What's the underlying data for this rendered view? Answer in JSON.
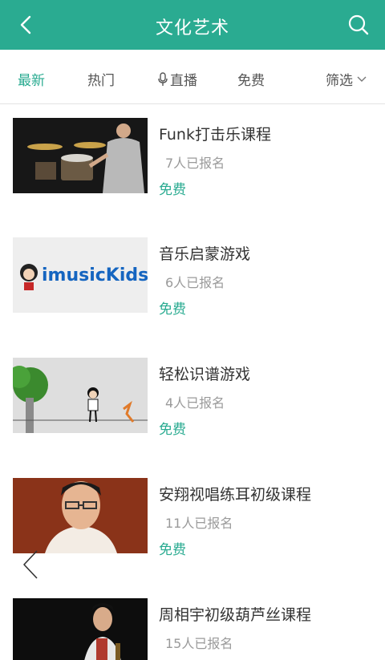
{
  "header": {
    "title": "文化艺术",
    "back_icon": "chevron-left-icon",
    "search_icon": "search-icon",
    "bg_color": "#2aab91"
  },
  "tabs": [
    {
      "label": "最新",
      "active": true
    },
    {
      "label": "热门",
      "active": false
    },
    {
      "label": "直播",
      "icon": "microphone-icon",
      "active": false
    },
    {
      "label": "免费",
      "active": false
    },
    {
      "label": "筛选",
      "icon": "chevron-down-icon",
      "active": false
    }
  ],
  "courses": [
    {
      "title": "Funk打击乐课程",
      "enrolled": "7人已报名",
      "price": "免费",
      "thumb_label": ""
    },
    {
      "title": "音乐启蒙游戏",
      "enrolled": "6人已报名",
      "price": "免费",
      "thumb_label": "imusicKids"
    },
    {
      "title": "轻松识谱游戏",
      "enrolled": "4人已报名",
      "price": "免费",
      "thumb_label": ""
    },
    {
      "title": "安翔视唱练耳初级课程",
      "enrolled": "11人已报名",
      "price": "免费",
      "thumb_label": ""
    },
    {
      "title": "周相宇初级葫芦丝课程",
      "enrolled": "15人已报名",
      "price": "免费",
      "thumb_label": ""
    }
  ],
  "overlay": {
    "icon": "chevron-left-icon"
  },
  "accent_color": "#2aab91"
}
